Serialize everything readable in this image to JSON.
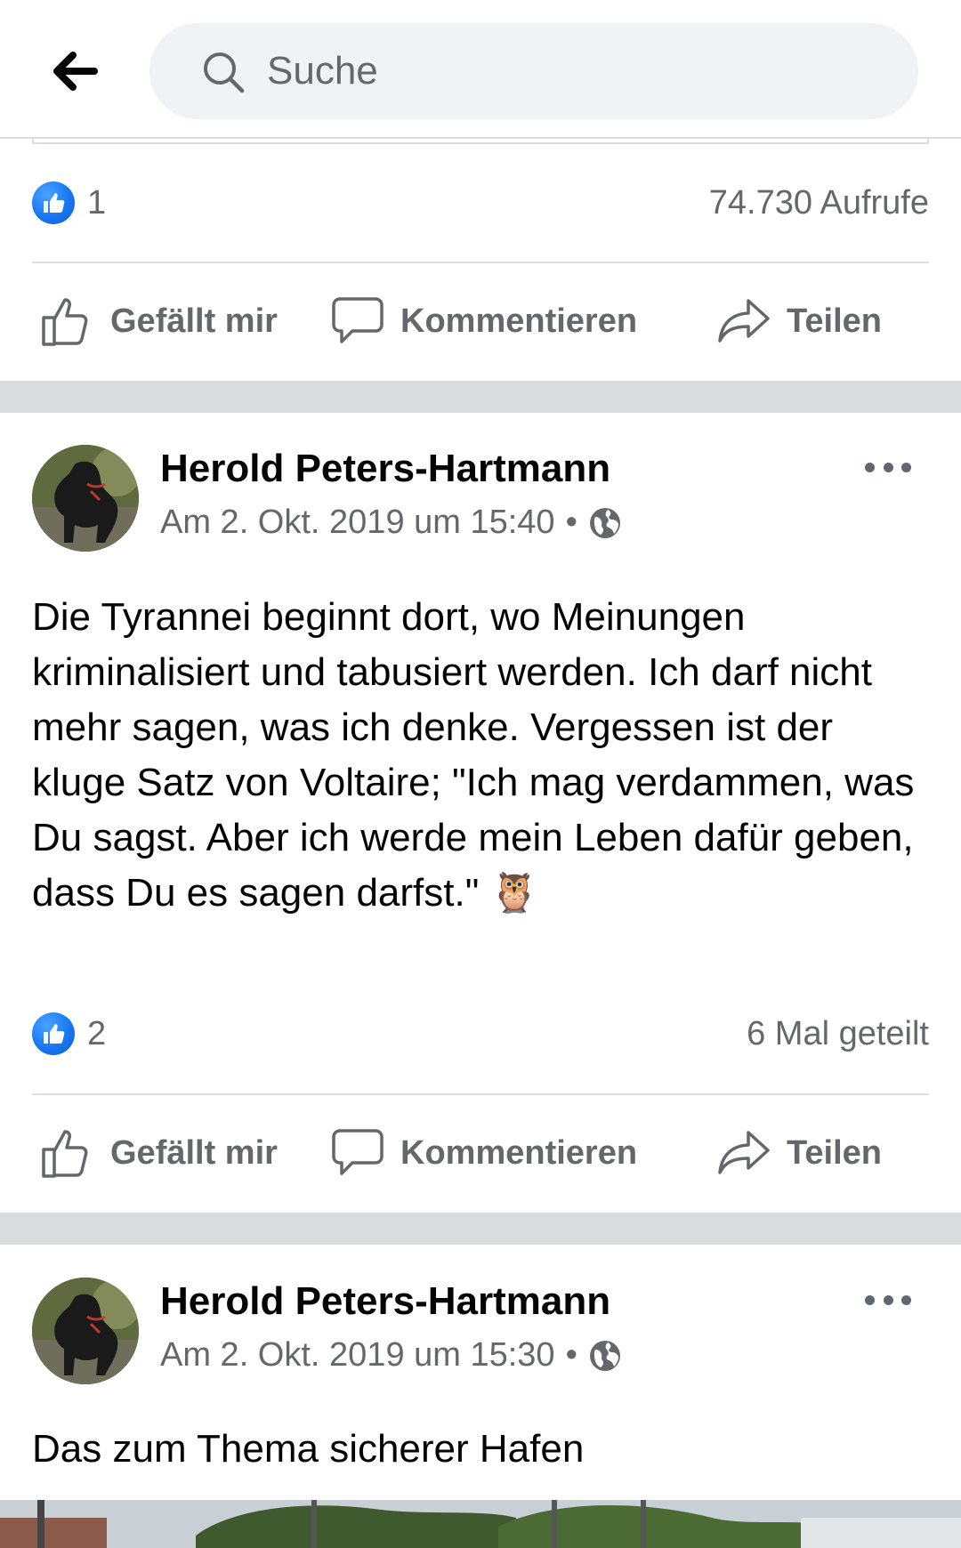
{
  "search": {
    "placeholder": "Suche"
  },
  "prev_post": {
    "reactions": "1",
    "views": "74.730 Aufrufe"
  },
  "actions": {
    "like": "Gefällt mir",
    "comment": "Kommentieren",
    "share": "Teilen"
  },
  "post1": {
    "author": "Herold Peters-Hartmann",
    "timestamp": "Am 2. Okt. 2019 um 15:40",
    "dot": "•",
    "text": "Die Tyrannei beginnt dort, wo Meinungen kriminalisiert und tabusiert werden. Ich darf nicht mehr sagen, was ich denke. Vergessen ist der kluge Satz von Voltaire; \"Ich mag verdammen, was Du sagst. Aber ich werde mein Leben dafür geben, dass Du es sagen darfst.\" 🦉",
    "reactions": "2",
    "shares": "6 Mal geteilt"
  },
  "post2": {
    "author": "Herold Peters-Hartmann",
    "timestamp": "Am 2. Okt. 2019 um 15:30",
    "dot": "•",
    "text": "Das zum Thema sicherer Hafen"
  },
  "colors": {
    "like_blue": "#1877f2",
    "secondary_text": "#65676b",
    "separator": "#d9dbdf"
  },
  "icons": [
    "back-arrow-icon",
    "search-icon",
    "like-reaction-icon",
    "thumbs-up-outline-icon",
    "comment-bubble-icon",
    "share-arrow-icon",
    "globe-icon",
    "more-dots-icon"
  ]
}
